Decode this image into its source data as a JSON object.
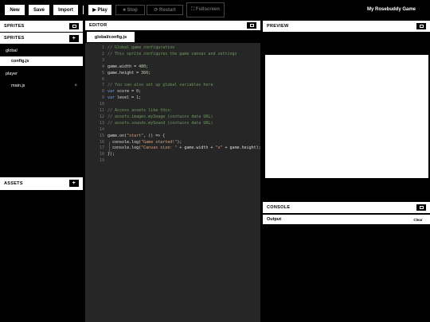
{
  "toolbar": {
    "new_label": "New",
    "save_label": "Save",
    "import_label": "Import",
    "play_label": "▶ Play",
    "stop_label": "■ Stop",
    "restart_label": "⟳ Restart",
    "fullscreen_label": "⛶ Fullscreen",
    "project_name": "My Rosebuddy Game"
  },
  "sprites_panel": {
    "title": "SPRITES",
    "subheader": "SPRITES",
    "add_symbol": "+",
    "items": [
      {
        "label": "global",
        "indent": 0,
        "selected": false
      },
      {
        "label": "config.js",
        "indent": 1,
        "selected": true
      },
      {
        "label": "player",
        "indent": 0,
        "selected": false
      },
      {
        "label": "main.js",
        "indent": 1,
        "selected": false,
        "close": "×"
      }
    ]
  },
  "assets_panel": {
    "title": "ASSETS",
    "add_symbol": "+"
  },
  "editor": {
    "title": "EDITOR",
    "active_tab": "global/config.js",
    "lines": [
      {
        "n": "1",
        "text": "// Global game configuration",
        "kind": "cmt"
      },
      {
        "n": "2",
        "text": "// This sprite configures the game canvas and settings",
        "kind": "cmt"
      },
      {
        "n": "3",
        "text": "",
        "kind": "plain"
      },
      {
        "n": "4",
        "text": "game.width = 480;",
        "kind": "plain"
      },
      {
        "n": "5",
        "text": "game.height = 360;",
        "kind": "plain"
      },
      {
        "n": "6",
        "text": "",
        "kind": "plain"
      },
      {
        "n": "7",
        "text": "// You can also set up global variables here",
        "kind": "cmt"
      },
      {
        "n": "8",
        "text": "var score = 0;",
        "kind": "plain"
      },
      {
        "n": "9",
        "text": "var level = 1;",
        "kind": "plain"
      },
      {
        "n": "10",
        "text": "",
        "kind": "plain"
      },
      {
        "n": "11",
        "text": "// Access assets like this:",
        "kind": "cmt"
      },
      {
        "n": "12",
        "text": "// assets.images.myImage (contains data URL)",
        "kind": "cmt"
      },
      {
        "n": "13",
        "text": "// assets.sounds.mySound (contains data URL)",
        "kind": "cmt"
      },
      {
        "n": "14",
        "text": "",
        "kind": "plain"
      },
      {
        "n": "15",
        "text": "game.on(\"start\", () => {",
        "kind": "plain"
      },
      {
        "n": "16",
        "text": "  console.log(\"Game started!\");",
        "kind": "plain"
      },
      {
        "n": "17",
        "text": "  console.log(\"Canvas size: \" + game.width + \"x\" + game.height);",
        "kind": "plain"
      },
      {
        "n": "18",
        "text": "});",
        "kind": "plain"
      },
      {
        "n": "19",
        "text": "",
        "kind": "plain"
      }
    ]
  },
  "preview_panel": {
    "title": "PREVIEW"
  },
  "console_panel": {
    "title": "CONSOLE",
    "output_label": "Output",
    "clear_label": "Clear"
  },
  "colors": {
    "background": "#000000",
    "panel_header": "#ffffff",
    "editor_bg": "#262626",
    "comment": "#6f9a5f",
    "keyword": "#6a9fd4",
    "string": "#d8a27e"
  }
}
